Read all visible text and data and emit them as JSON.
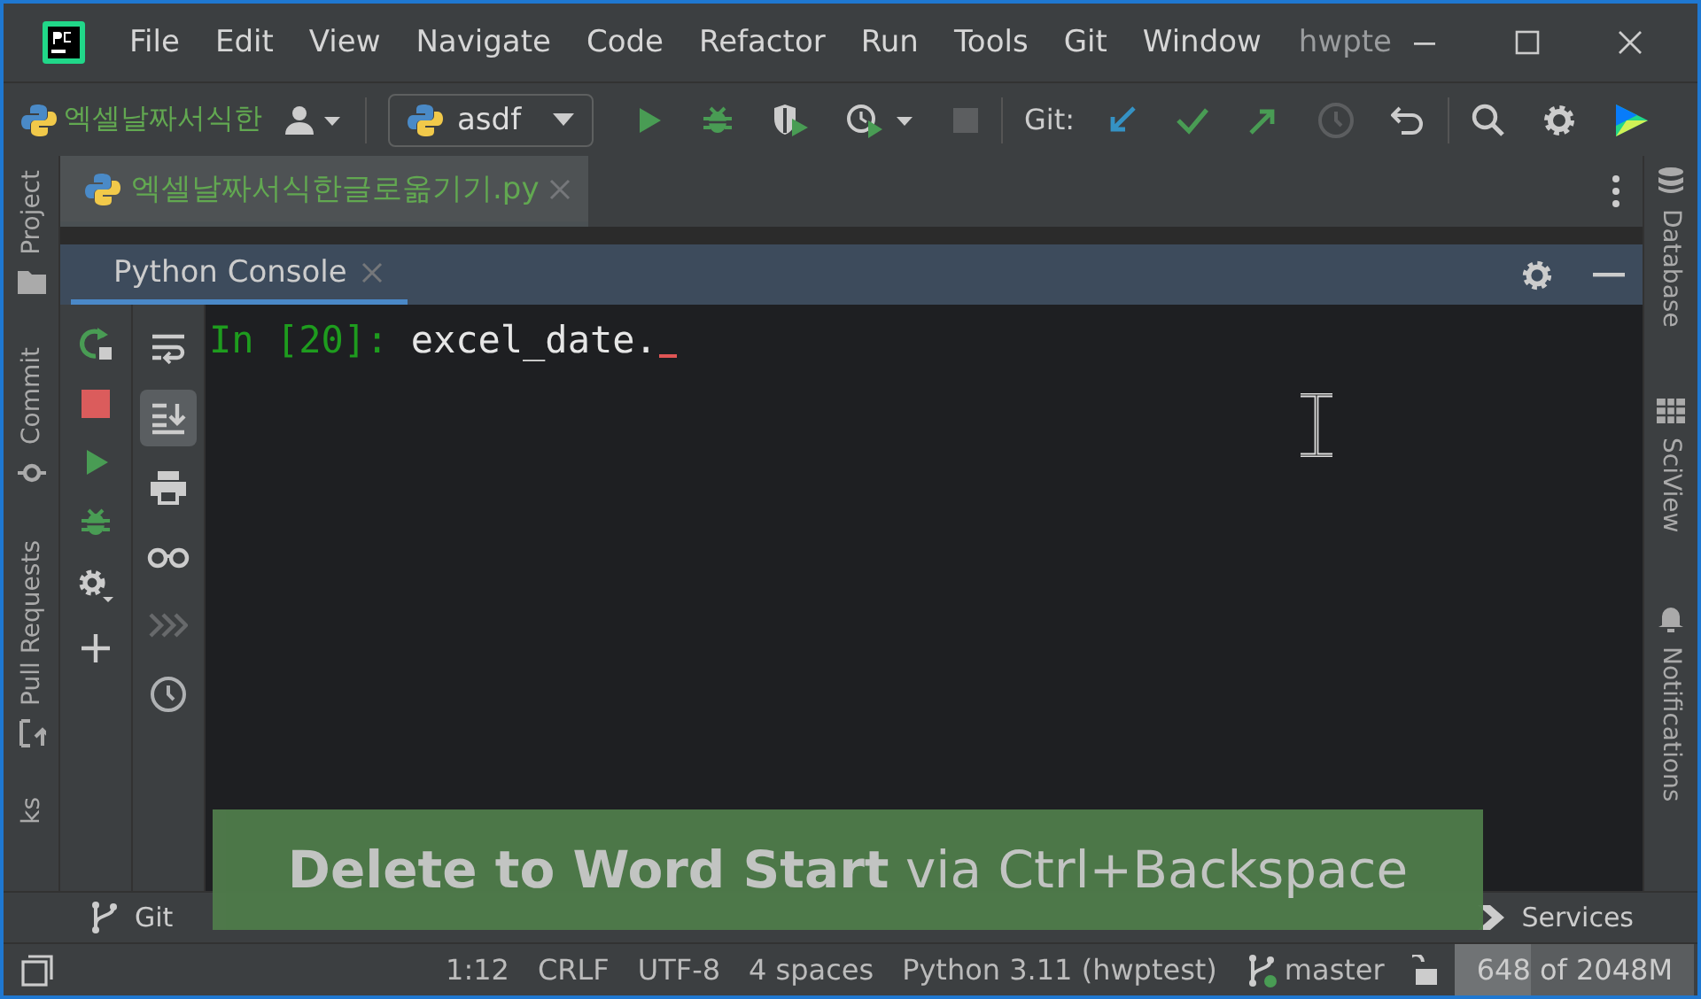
{
  "window": {
    "menu": [
      {
        "label": "File"
      },
      {
        "label": "Edit"
      },
      {
        "label": "View"
      },
      {
        "label": "Navigate"
      },
      {
        "label": "Code"
      },
      {
        "label": "Refactor"
      },
      {
        "label": "Run"
      },
      {
        "label": "Tools"
      },
      {
        "label": "Git"
      },
      {
        "label": "Window"
      }
    ],
    "title": "hwpte"
  },
  "toolbar": {
    "project": "엑셀날짜서식한",
    "run_config": "asdf",
    "git_label": "Git:"
  },
  "editor_tabs": [
    {
      "label": "엑셀날짜서식한글로옮기기.py",
      "selected": true
    }
  ],
  "left_stripe": [
    {
      "label": "Project"
    },
    {
      "label": "Commit"
    },
    {
      "label": "Pull Requests"
    },
    {
      "label": "ks"
    }
  ],
  "right_stripe": [
    {
      "label": "Database"
    },
    {
      "label": "SciView"
    },
    {
      "label": "Notifications"
    }
  ],
  "console": {
    "tab": "Python Console",
    "prompt": "In [20]:",
    "input": "excel_date.",
    "view_tools": [
      {
        "on": false,
        "disabled": false
      },
      {
        "on": true,
        "disabled": false
      },
      {
        "on": false,
        "disabled": false
      },
      {
        "on": false,
        "disabled": false
      },
      {
        "on": false,
        "disabled": true
      },
      {
        "on": false,
        "disabled": false
      }
    ]
  },
  "tooltip": {
    "text": "**Delete to Word Start** via Ctrl+Backspace"
  },
  "bottom_bar": [
    {
      "label": "Git"
    },
    {
      "label": "Services"
    }
  ],
  "status_bar": {
    "items": [
      "1:12",
      "CRLF",
      "UTF-8",
      "4 spaces",
      "Python 3.11 (hwptest)"
    ],
    "branch": "master",
    "memory": {
      "text": "648 of 2048M",
      "level": 0.32
    }
  }
}
